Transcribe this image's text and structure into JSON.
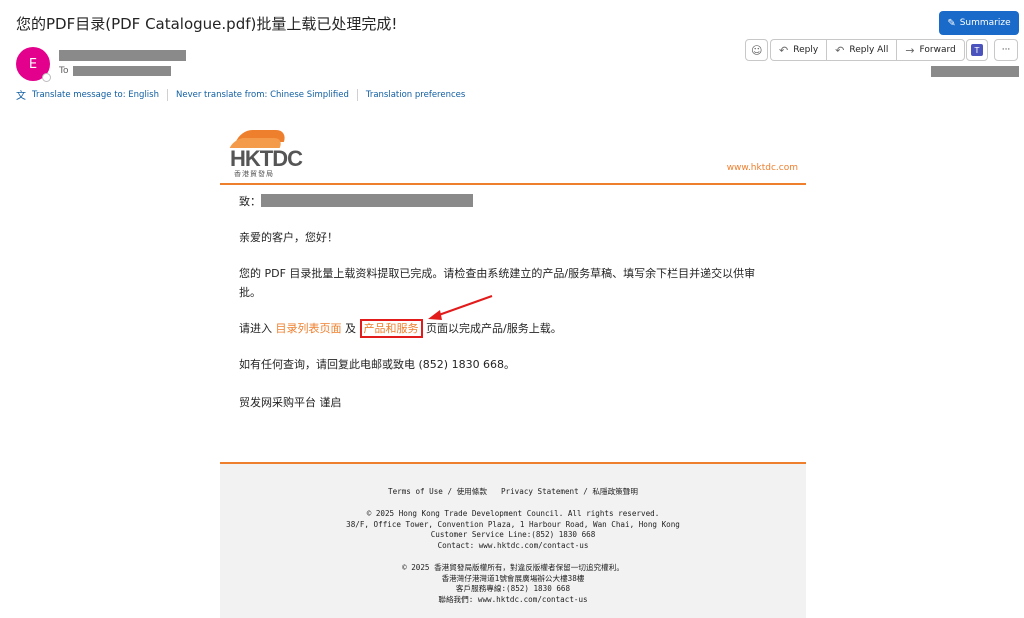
{
  "subject": "您的PDF目录(PDF Catalogue.pdf)批量上载已处理完成!",
  "summarize": {
    "label": "Summarize",
    "icon": "sparkle-icon"
  },
  "sender": {
    "avatar_letter": "E",
    "to_label": "To"
  },
  "actions": {
    "emoji_icon": "smiley-icon",
    "reply": "Reply",
    "reply_all": "Reply All",
    "forward": "Forward",
    "teams_icon": "teams-icon",
    "more_icon": "more-icon"
  },
  "translate_bar": {
    "translate": "Translate message to: English",
    "never": "Never translate from: Chinese Simplified",
    "prefs": "Translation preferences"
  },
  "email": {
    "logo_text": "HKTDC",
    "logo_sub": "香港貿發局",
    "website": "www.hktdc.com",
    "to_prefix": "致：",
    "greeting": "亲爱的客户，您好！",
    "para1_line1": "您的 PDF 目录批量上载资料提取已完成。请检查由系统建立的产品/服务草稿、填写余下栏目并递交以供审",
    "para1_line2": "批。",
    "para2_prefix": "请进入",
    "link_catalog": "目录列表页面",
    "para2_and": "及",
    "link_products": "产品和服务",
    "para2_suffix": "页面以完成产品/服务上载。",
    "contact": "如有任何查询，请回复此电邮或致电 (852) 1830 668。",
    "signoff": "贸发网采购平台 谨启"
  },
  "footer": {
    "terms": "Terms of Use / 使用條款",
    "privacy": "Privacy Statement / 私隱政策聲明",
    "en_copyright": "© 2025 Hong Kong Trade Development Council. All rights reserved.",
    "en_address": "38/F, Office Tower, Convention Plaza, 1 Harbour Road, Wan Chai, Hong Kong",
    "en_service": "Customer Service Line:(852) 1830 668",
    "en_contact": "Contact: www.hktdc.com/contact-us",
    "zh_copyright": "© 2025 香港貿發局版權所有，對違反版權者保留一切追究權利。",
    "zh_address": "香港灣仔港灣道1號會展廣場辦公大樓38樓",
    "zh_service": "客戶服務專線:(852) 1830 668",
    "zh_contact": "聯絡我們: www.hktdc.com/contact-us"
  },
  "colors": {
    "accent": "#1a6bc9",
    "brand_orange": "#ee7f2d",
    "avatar": "#e3008c",
    "highlight": "#e21b1b"
  }
}
